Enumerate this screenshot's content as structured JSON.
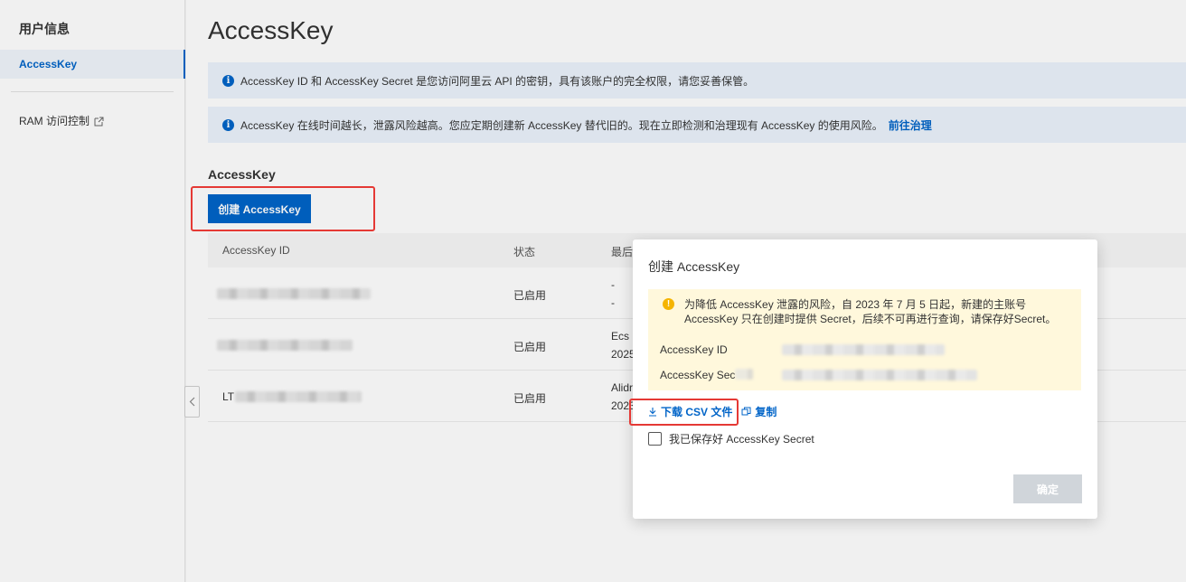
{
  "sidebar": {
    "title": "用户信息",
    "active_item": "AccessKey",
    "ram_link": "RAM 访问控制"
  },
  "main": {
    "page_title": "AccessKey",
    "notice1": "AccessKey ID 和 AccessKey Secret 是您访问阿里云 API 的密钥，具有该账户的完全权限，请您妥善保管。",
    "notice2": "AccessKey 在线时间越长，泄露风险越高。您应定期创建新 AccessKey 替代旧的。现在立即检测和治理现有 AccessKey 的使用风险。",
    "notice2_link": "前往治理",
    "section_title": "AccessKey",
    "create_button": "创建 AccessKey"
  },
  "table": {
    "columns": [
      "AccessKey ID",
      "状态",
      "最后"
    ],
    "rows": [
      {
        "id_visible": "",
        "status": "已启用",
        "last_line1": "-",
        "last_line2": "-"
      },
      {
        "id_visible": "",
        "status": "已启用",
        "last_line1": "Ecs",
        "last_line2": "2025"
      },
      {
        "id_visible": "LT",
        "status": "已启用",
        "last_line1": "Alidr",
        "last_line2": "2023"
      }
    ]
  },
  "modal": {
    "title": "创建 AccessKey",
    "warning": "为降低 AccessKey 泄露的风险，自 2023 年 7 月 5 日起，新建的主账号 AccessKey 只在创建时提供 Secret，后续不可再进行查询，请保存好Secret。",
    "id_label": "AccessKey ID",
    "secret_label": "AccessKey Sec",
    "download_csv": "下载 CSV 文件",
    "copy": "复制",
    "saved_checkbox": "我已保存好 AccessKey Secret",
    "confirm": "确定"
  },
  "colors": {
    "primary": "#0064c8",
    "notice_bg": "#ebf3fc",
    "warning_bg": "#fff8dc",
    "highlight_red": "#e53935"
  }
}
